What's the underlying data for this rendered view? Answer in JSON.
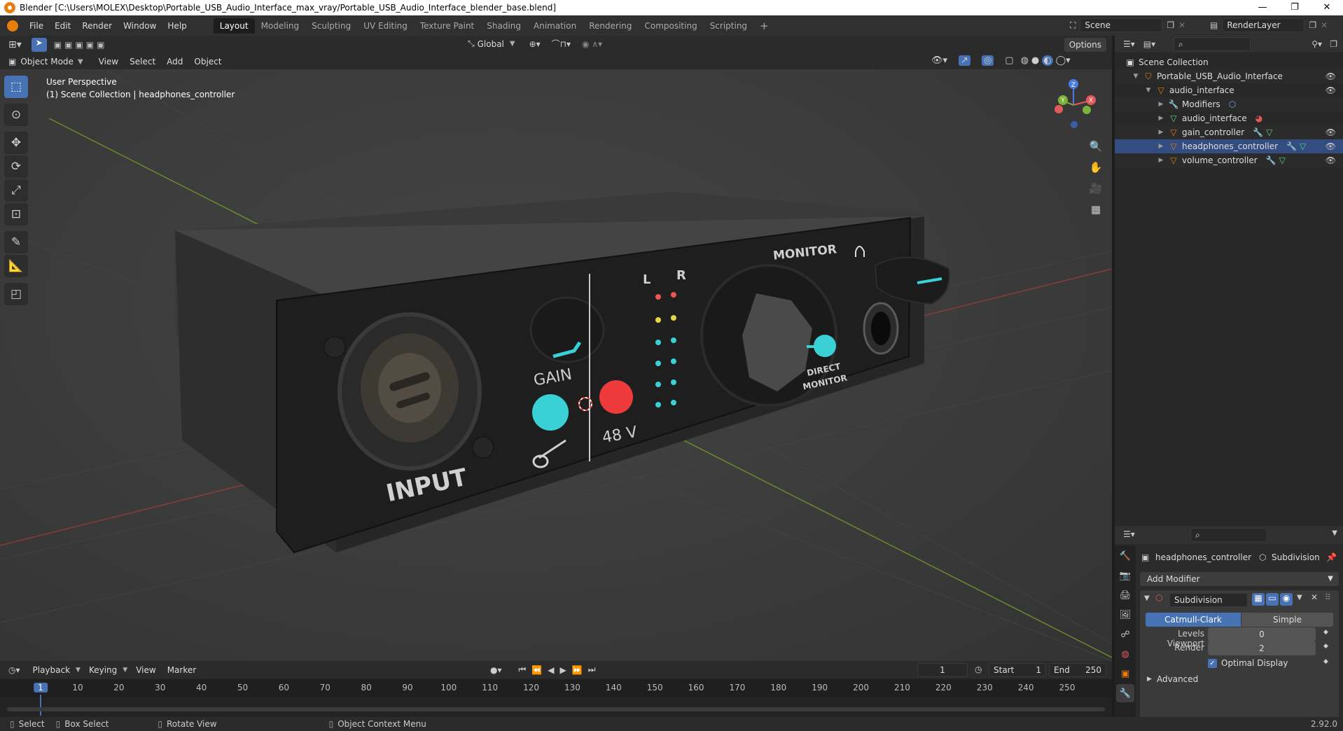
{
  "window": {
    "title": "Blender [C:\\Users\\MOLEX\\Desktop\\Portable_USB_Audio_Interface_max_vray/Portable_USB_Audio_Interface_blender_base.blend]",
    "minimize": "—",
    "maximize": "❐",
    "close": "✕"
  },
  "menu": [
    "File",
    "Edit",
    "Render",
    "Window",
    "Help"
  ],
  "workspaces": [
    "Layout",
    "Modeling",
    "Sculpting",
    "UV Editing",
    "Texture Paint",
    "Shading",
    "Animation",
    "Rendering",
    "Compositing",
    "Scripting"
  ],
  "active_workspace": "Layout",
  "add_workspace": "+",
  "scene": {
    "name": "Scene",
    "render_layer": "RenderLayer"
  },
  "viewport_header": {
    "transform_orientation": "Global",
    "options": "Options",
    "mode": "Object Mode",
    "view_menu": [
      "View",
      "Select",
      "Add",
      "Object"
    ]
  },
  "viewport_overlay": {
    "line1": "User Perspective",
    "line2": "(1) Scene Collection | headphones_controller"
  },
  "gizmo": {
    "x": "X",
    "y": "Y",
    "z": "Z"
  },
  "device_labels": {
    "input": "INPUT",
    "gain": "GAIN",
    "phantom": "48 V",
    "left": "L",
    "right": "R",
    "monitor": "MONITOR",
    "direct1": "DIRECT",
    "direct2": "MONITOR"
  },
  "outliner": {
    "root": "Scene Collection",
    "items": [
      {
        "label": "Portable_USB_Audio_Interface",
        "depth": 1
      },
      {
        "label": "audio_interface",
        "depth": 2
      },
      {
        "label": "Modifiers",
        "depth": 3
      },
      {
        "label": "audio_interface",
        "depth": 3
      },
      {
        "label": "gain_controller",
        "depth": 3
      },
      {
        "label": "headphones_controller",
        "depth": 3,
        "selected": true
      },
      {
        "label": "volume_controller",
        "depth": 3
      }
    ]
  },
  "properties": {
    "object": "headphones_controller",
    "modifier_crumb": "Subdivision",
    "add_modifier": "Add Modifier",
    "modifier_name": "Subdivision",
    "algo_catmull": "Catmull-Clark",
    "algo_simple": "Simple",
    "levels_viewport_label": "Levels Viewport",
    "levels_viewport": "0",
    "render_label": "Render",
    "render_value": "2",
    "optimal_display": "Optimal Display",
    "advanced": "Advanced"
  },
  "timeline": {
    "menus": [
      "Playback",
      "Keying",
      "View",
      "Marker"
    ],
    "current_frame": "1",
    "start_label": "Start",
    "start": "1",
    "end_label": "End",
    "end": "250",
    "ticks": [
      "1",
      "10",
      "20",
      "30",
      "40",
      "50",
      "60",
      "70",
      "80",
      "90",
      "100",
      "110",
      "120",
      "130",
      "140",
      "150",
      "160",
      "170",
      "180",
      "190",
      "200",
      "210",
      "220",
      "230",
      "240",
      "250"
    ]
  },
  "status": {
    "select": "Select",
    "box_select": "Box Select",
    "rotate_view": "Rotate View",
    "context_menu": "Object Context Menu",
    "version": "2.92.0"
  },
  "colors": {
    "accent": "#4772b3",
    "cyan": "#3ad1d6",
    "red": "#ee3a3a",
    "orange": "#e87d0d"
  }
}
